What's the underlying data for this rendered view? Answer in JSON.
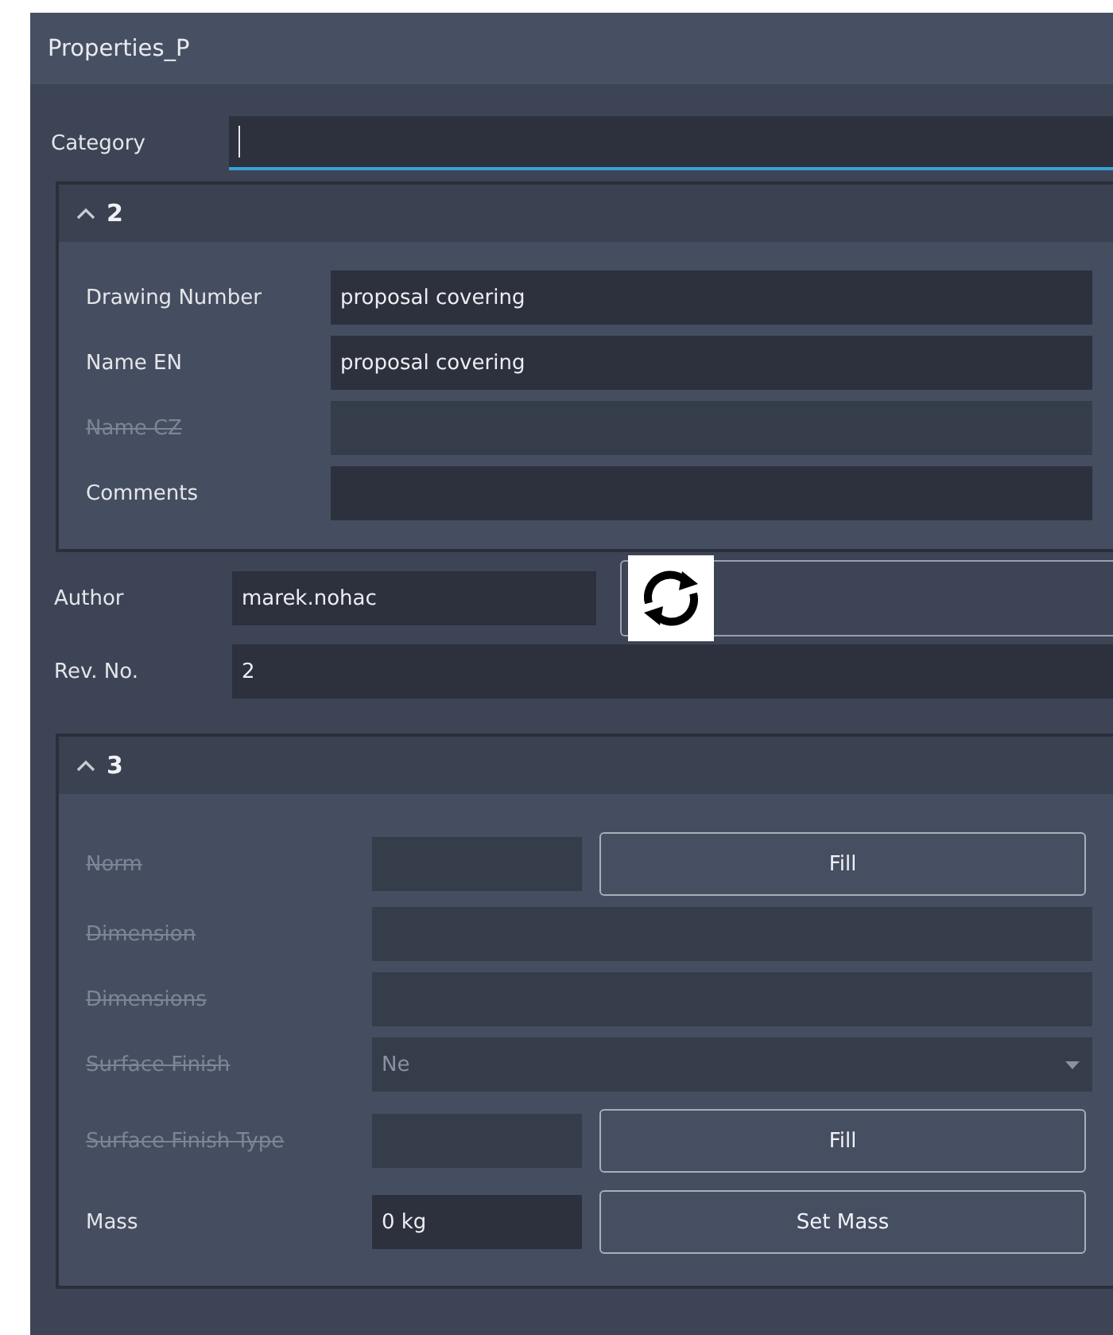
{
  "window": {
    "title": "Properties_P"
  },
  "category": {
    "label": "Category",
    "focused": true
  },
  "section_2": {
    "expanded": true,
    "title": "2",
    "rows": [
      {
        "label": "Drawing Number",
        "value": "proposal covering",
        "disabled": false
      },
      {
        "label": "Name EN",
        "value": "proposal covering",
        "disabled": false
      },
      {
        "label": "Name CZ",
        "disabled": true
      },
      {
        "label": "Comments",
        "disabled": false
      }
    ]
  },
  "author": {
    "label": "Author",
    "value": "marek.nohac"
  },
  "revision": {
    "label": "Rev. No.",
    "value": "2"
  },
  "section_3": {
    "expanded": true,
    "title": "3",
    "rows": [
      {
        "kind": "button",
        "label": "Norm",
        "disabled": true,
        "button": "Fill"
      },
      {
        "kind": "text",
        "label": "Dimension",
        "disabled": true
      },
      {
        "kind": "text",
        "label": "Dimensions",
        "disabled": true
      },
      {
        "kind": "select",
        "label": "Surface Finish",
        "value": "Ne",
        "disabled": true
      },
      {
        "kind": "button",
        "label": "Surface Finish Type",
        "disabled": true,
        "button": "Fill"
      },
      {
        "kind": "button",
        "label": "Mass",
        "value": "0 kg",
        "disabled": false,
        "button": "Set Mass"
      }
    ]
  }
}
